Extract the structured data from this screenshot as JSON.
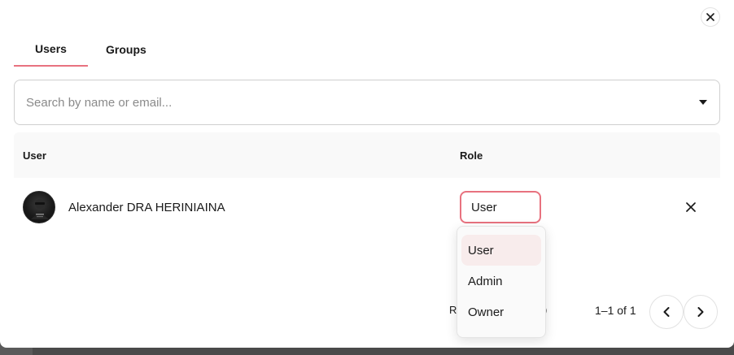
{
  "tabs": [
    {
      "label": "Users",
      "active": true
    },
    {
      "label": "Groups",
      "active": false
    }
  ],
  "search": {
    "placeholder": "Search by name or email...",
    "value": ""
  },
  "table": {
    "columns": {
      "user": "User",
      "role": "Role"
    },
    "rows": [
      {
        "name": "Alexander DRA HERINIAINA",
        "role": "User"
      }
    ]
  },
  "role_menu": {
    "options": [
      "User",
      "Admin",
      "Owner"
    ],
    "selected": "User"
  },
  "footer": {
    "rows_label_fragment": "R",
    "rows_tail_fragment": ")",
    "page_range": "1–1 of 1"
  },
  "colors": {
    "accent": "#e8727f",
    "selected_option_bg": "#f8ecec"
  },
  "icons": {
    "close": "close-icon",
    "caret": "caret-down-icon",
    "remove": "close-icon",
    "prev": "chevron-left-icon",
    "next": "chevron-right-icon"
  }
}
